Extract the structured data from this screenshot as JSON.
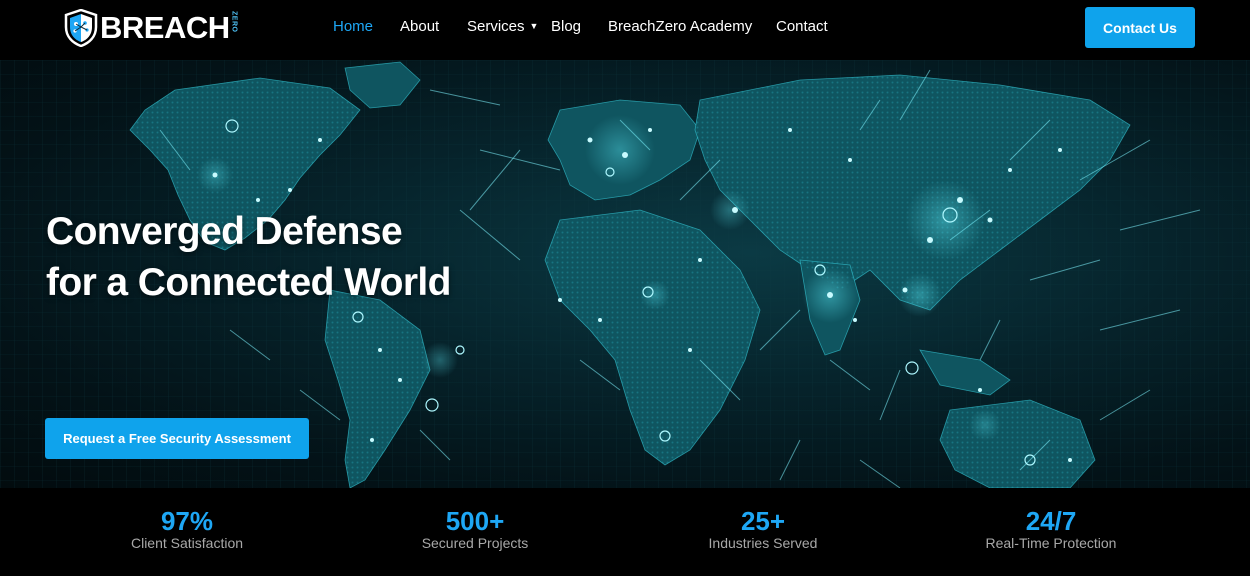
{
  "brand": {
    "name": "BREACH",
    "sub": "ZERO"
  },
  "nav": {
    "items": [
      {
        "label": "Home",
        "active": true
      },
      {
        "label": "About"
      },
      {
        "label": "Services",
        "has_dropdown": true
      },
      {
        "label": "Blog"
      },
      {
        "label": "BreachZero Academy"
      },
      {
        "label": "Contact"
      }
    ],
    "cta_label": "Contact Us"
  },
  "hero": {
    "title_line1": "Converged Defense",
    "title_line2": "for a Connected World",
    "cta_label": "Request a Free Security Assessment"
  },
  "stats": [
    {
      "value": "97%",
      "label": "Client Satisfaction"
    },
    {
      "value": "500+",
      "label": "Secured Projects"
    },
    {
      "value": "25+",
      "label": "Industries Served"
    },
    {
      "value": "24/7",
      "label": "Real-Time Protection"
    }
  ],
  "colors": {
    "accent": "#0fa3ec",
    "stat_value": "#1ea7f5",
    "background": "#000000"
  },
  "icons": {
    "logo": "shield-brain-icon",
    "dropdown": "chevron-down-icon"
  }
}
